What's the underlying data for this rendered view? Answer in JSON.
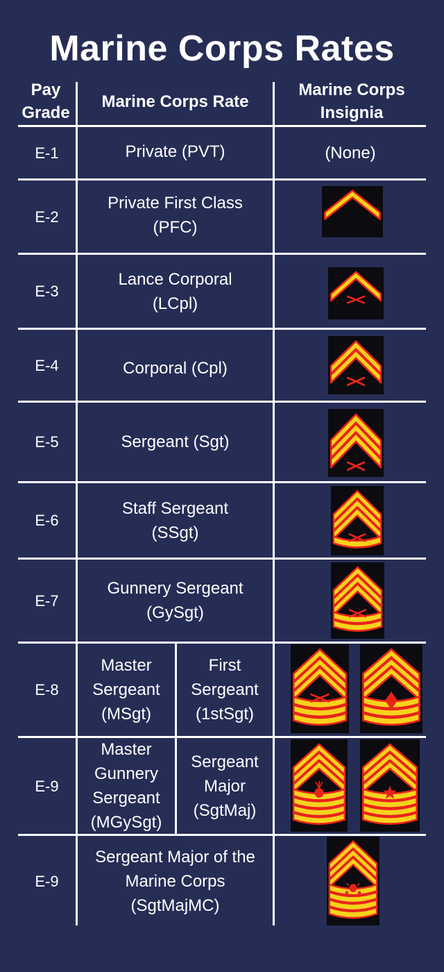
{
  "title": "Marine Corps Rates",
  "headers": {
    "pay_grade": "Pay\nGrade",
    "rate": "Marine Corps Rate",
    "insignia": "Marine Corps\nInsignia"
  },
  "rows": [
    {
      "grade": "E-1",
      "rate": "Private (PVT)",
      "insignia_text": "(None)"
    },
    {
      "grade": "E-2",
      "rate": "Private First Class\n(PFC)"
    },
    {
      "grade": "E-3",
      "rate": "Lance Corporal\n(LCpl)"
    },
    {
      "grade": "E-4",
      "rate": "Corporal (Cpl)"
    },
    {
      "grade": "E-5",
      "rate": "Sergeant (Sgt)"
    },
    {
      "grade": "E-6",
      "rate": "Staff Sergeant\n(SSgt)"
    },
    {
      "grade": "E-7",
      "rate": "Gunnery Sergeant\n(GySgt)"
    },
    {
      "grade": "E-8",
      "rate_a": "Master\nSergeant\n(MSgt)",
      "rate_b": "First\nSergeant\n(1stSgt)"
    },
    {
      "grade": "E-9",
      "rate_a": "Master\nGunnery\nSergeant\n(MGySgt)",
      "rate_b": "Sergeant\nMajor\n(SgtMaj)"
    },
    {
      "grade": "E-9",
      "rate": "Sergeant Major of the\nMarine Corps\n(SgtMajMC)"
    }
  ],
  "insignia_icons": [
    "pfc-chevron-icon",
    "lcpl-chevron-icon",
    "cpl-chevron-icon",
    "sgt-chevron-icon",
    "ssgt-chevron-icon",
    "gysgt-chevron-icon",
    "msgt-chevron-icon",
    "1stsgt-chevron-icon",
    "mgysgt-chevron-icon",
    "sgtmaj-chevron-icon",
    "sgtmajmc-chevron-icon"
  ],
  "colors": {
    "background": "#262d55",
    "chevron_fill": "#f7d21e",
    "chevron_border": "#e8241a",
    "patch_background": "#0b0b10"
  }
}
